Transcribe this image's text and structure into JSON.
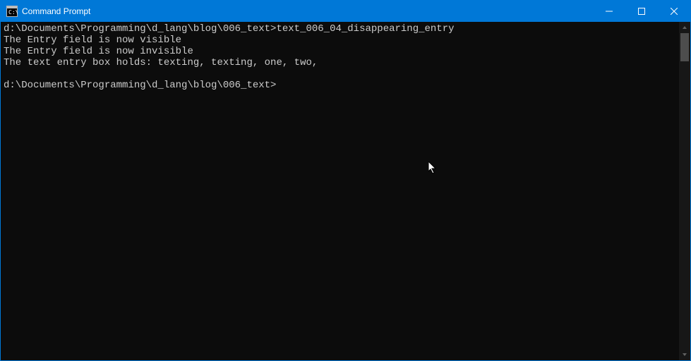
{
  "window": {
    "title": "Command Prompt",
    "controls": {
      "minimize": "Minimize",
      "maximize": "Maximize",
      "close": "Close"
    }
  },
  "terminal": {
    "lines": [
      {
        "prompt": "d:\\Documents\\Programming\\d_lang\\blog\\006_text>",
        "cmd": "text_006_04_disappearing_entry"
      },
      {
        "text": "The Entry field is now visible"
      },
      {
        "text": "The Entry field is now invisible"
      },
      {
        "text": "The text entry box holds: texting, texting, one, two,"
      },
      {
        "text": ""
      },
      {
        "prompt": "d:\\Documents\\Programming\\d_lang\\blog\\006_text>",
        "cmd": ""
      }
    ]
  },
  "colors": {
    "titlebar": "#0078d7",
    "terminal_bg": "#0c0c0c",
    "terminal_fg": "#cccccc"
  }
}
